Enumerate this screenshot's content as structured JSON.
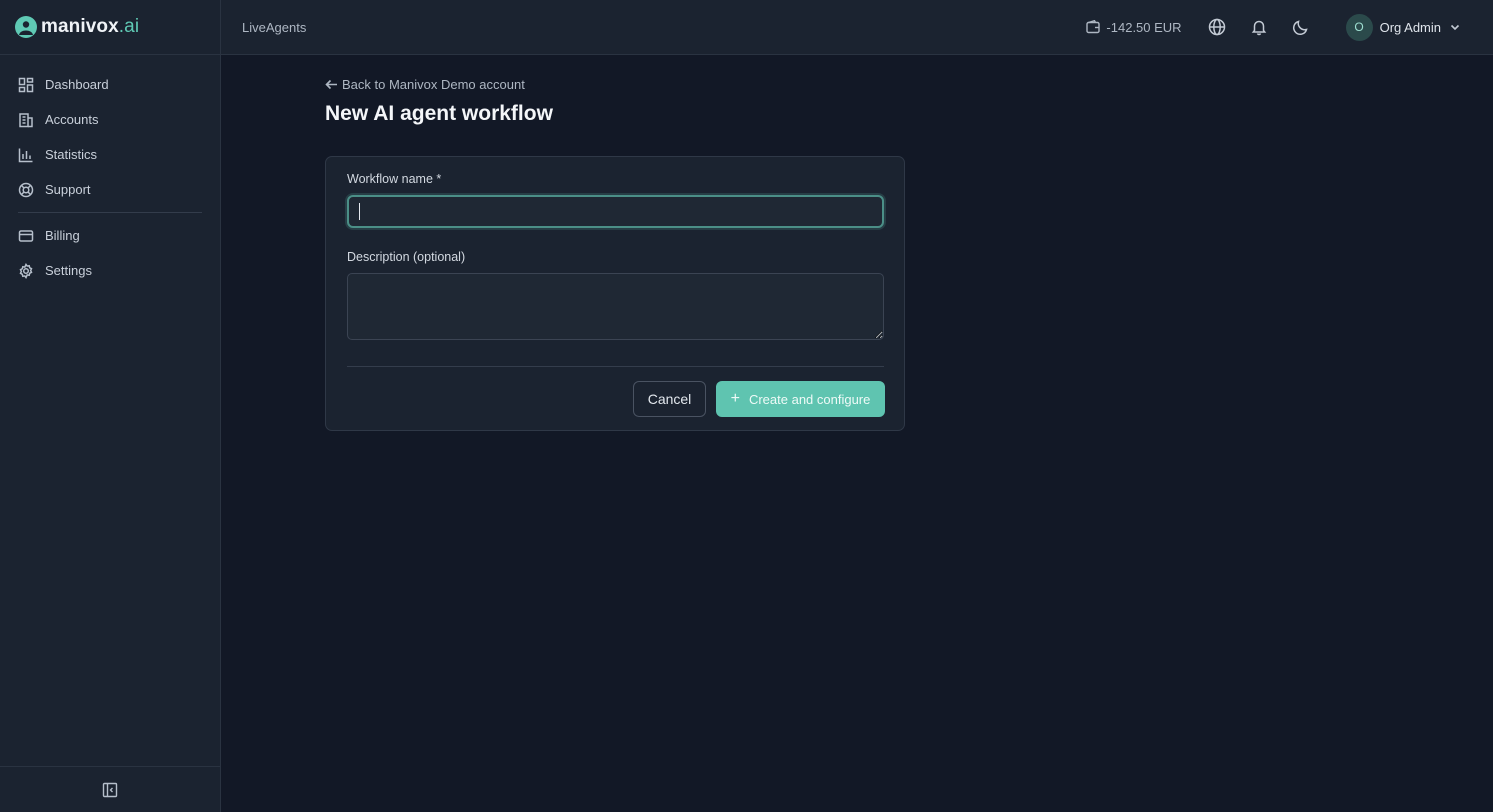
{
  "brand": {
    "name": "manivox",
    "suffix": ".ai",
    "accent": "#5fc9b4"
  },
  "sidebar": {
    "items": [
      {
        "label": "Dashboard",
        "icon": "dashboard-icon"
      },
      {
        "label": "Accounts",
        "icon": "building-icon"
      },
      {
        "label": "Statistics",
        "icon": "bar-chart-icon"
      },
      {
        "label": "Support",
        "icon": "lifebuoy-icon"
      },
      {
        "label": "Billing",
        "icon": "credit-card-icon"
      },
      {
        "label": "Settings",
        "icon": "gear-icon"
      }
    ],
    "collapse_icon": "sidebar-collapse-icon"
  },
  "topbar": {
    "breadcrumb": "LiveAgents",
    "balance": "-142.50 EUR",
    "user": {
      "initial": "O",
      "name": "Org Admin"
    }
  },
  "page": {
    "back_link": "Back to Manivox Demo account",
    "title": "New AI agent workflow"
  },
  "form": {
    "name_label": "Workflow name *",
    "name_value": "",
    "description_label": "Description (optional)",
    "description_value": "",
    "cancel_label": "Cancel",
    "submit_label": "Create and configure"
  }
}
